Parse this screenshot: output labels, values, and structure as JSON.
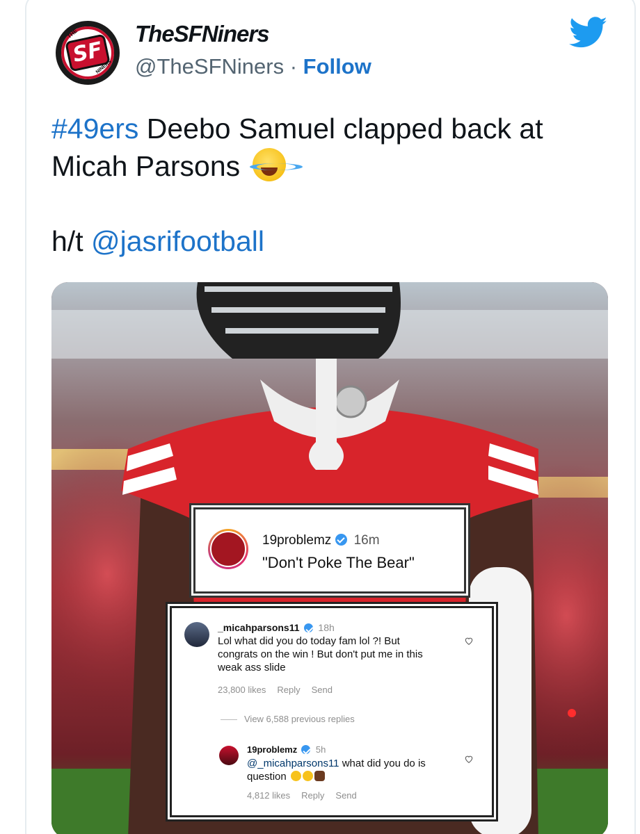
{
  "account": {
    "display_name": "TheSFNiners",
    "handle": "@TheSFNiners",
    "separator": " · ",
    "follow_label": "Follow",
    "logo_text": "SF",
    "logo_top": "THE",
    "logo_bottom": "NINERS"
  },
  "tweet": {
    "hashtag": "#49ers",
    "text": " Deebo Samuel clapped back at Micah Parsons ",
    "emoji": "face-with-tears-of-joy",
    "ht_prefix": "h/t ",
    "ht_mention": "@jasrifootball"
  },
  "media": {
    "reply_card": {
      "username": "19problemz",
      "time": "16m",
      "quote": "\"Don't Poke The Bear\""
    },
    "comment_card": {
      "comment1": {
        "username": "_micahparsons11",
        "time": "18h",
        "text": "Lol what did you do today fam lol ?! But congrats on the win ! But don't put me in this weak ass slide",
        "likes": "23,800 likes",
        "reply_label": "Reply",
        "send_label": "Send"
      },
      "view_replies": "View 6,588 previous replies",
      "comment2": {
        "username": "19problemz",
        "time": "5h",
        "mention": "@_micahparsons11",
        "text": " what did you do is question",
        "likes": "4,812 likes",
        "reply_label": "Reply",
        "send_label": "Send"
      }
    }
  },
  "colors": {
    "link_blue": "#1d73c9",
    "twitter_blue": "#1d9bf0",
    "niners_red": "#c8102e"
  }
}
